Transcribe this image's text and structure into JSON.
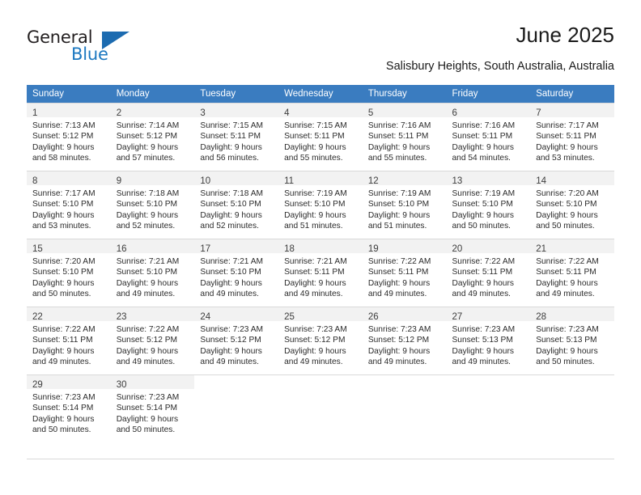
{
  "brand": {
    "name_part1": "General",
    "name_part2": "Blue",
    "accent_color": "#1c6bb0",
    "logo_icon": "triangle-flag-icon"
  },
  "header": {
    "title": "June 2025",
    "subtitle": "Salisbury Heights, South Australia, Australia"
  },
  "calendar": {
    "header_color": "#3a7cc0",
    "weekday_headers": [
      "Sunday",
      "Monday",
      "Tuesday",
      "Wednesday",
      "Thursday",
      "Friday",
      "Saturday"
    ],
    "weeks": [
      [
        {
          "day": "1",
          "sunrise": "Sunrise: 7:13 AM",
          "sunset": "Sunset: 5:12 PM",
          "daylight1": "Daylight: 9 hours",
          "daylight2": "and 58 minutes."
        },
        {
          "day": "2",
          "sunrise": "Sunrise: 7:14 AM",
          "sunset": "Sunset: 5:12 PM",
          "daylight1": "Daylight: 9 hours",
          "daylight2": "and 57 minutes."
        },
        {
          "day": "3",
          "sunrise": "Sunrise: 7:15 AM",
          "sunset": "Sunset: 5:11 PM",
          "daylight1": "Daylight: 9 hours",
          "daylight2": "and 56 minutes."
        },
        {
          "day": "4",
          "sunrise": "Sunrise: 7:15 AM",
          "sunset": "Sunset: 5:11 PM",
          "daylight1": "Daylight: 9 hours",
          "daylight2": "and 55 minutes."
        },
        {
          "day": "5",
          "sunrise": "Sunrise: 7:16 AM",
          "sunset": "Sunset: 5:11 PM",
          "daylight1": "Daylight: 9 hours",
          "daylight2": "and 55 minutes."
        },
        {
          "day": "6",
          "sunrise": "Sunrise: 7:16 AM",
          "sunset": "Sunset: 5:11 PM",
          "daylight1": "Daylight: 9 hours",
          "daylight2": "and 54 minutes."
        },
        {
          "day": "7",
          "sunrise": "Sunrise: 7:17 AM",
          "sunset": "Sunset: 5:11 PM",
          "daylight1": "Daylight: 9 hours",
          "daylight2": "and 53 minutes."
        }
      ],
      [
        {
          "day": "8",
          "sunrise": "Sunrise: 7:17 AM",
          "sunset": "Sunset: 5:10 PM",
          "daylight1": "Daylight: 9 hours",
          "daylight2": "and 53 minutes."
        },
        {
          "day": "9",
          "sunrise": "Sunrise: 7:18 AM",
          "sunset": "Sunset: 5:10 PM",
          "daylight1": "Daylight: 9 hours",
          "daylight2": "and 52 minutes."
        },
        {
          "day": "10",
          "sunrise": "Sunrise: 7:18 AM",
          "sunset": "Sunset: 5:10 PM",
          "daylight1": "Daylight: 9 hours",
          "daylight2": "and 52 minutes."
        },
        {
          "day": "11",
          "sunrise": "Sunrise: 7:19 AM",
          "sunset": "Sunset: 5:10 PM",
          "daylight1": "Daylight: 9 hours",
          "daylight2": "and 51 minutes."
        },
        {
          "day": "12",
          "sunrise": "Sunrise: 7:19 AM",
          "sunset": "Sunset: 5:10 PM",
          "daylight1": "Daylight: 9 hours",
          "daylight2": "and 51 minutes."
        },
        {
          "day": "13",
          "sunrise": "Sunrise: 7:19 AM",
          "sunset": "Sunset: 5:10 PM",
          "daylight1": "Daylight: 9 hours",
          "daylight2": "and 50 minutes."
        },
        {
          "day": "14",
          "sunrise": "Sunrise: 7:20 AM",
          "sunset": "Sunset: 5:10 PM",
          "daylight1": "Daylight: 9 hours",
          "daylight2": "and 50 minutes."
        }
      ],
      [
        {
          "day": "15",
          "sunrise": "Sunrise: 7:20 AM",
          "sunset": "Sunset: 5:10 PM",
          "daylight1": "Daylight: 9 hours",
          "daylight2": "and 50 minutes."
        },
        {
          "day": "16",
          "sunrise": "Sunrise: 7:21 AM",
          "sunset": "Sunset: 5:10 PM",
          "daylight1": "Daylight: 9 hours",
          "daylight2": "and 49 minutes."
        },
        {
          "day": "17",
          "sunrise": "Sunrise: 7:21 AM",
          "sunset": "Sunset: 5:10 PM",
          "daylight1": "Daylight: 9 hours",
          "daylight2": "and 49 minutes."
        },
        {
          "day": "18",
          "sunrise": "Sunrise: 7:21 AM",
          "sunset": "Sunset: 5:11 PM",
          "daylight1": "Daylight: 9 hours",
          "daylight2": "and 49 minutes."
        },
        {
          "day": "19",
          "sunrise": "Sunrise: 7:22 AM",
          "sunset": "Sunset: 5:11 PM",
          "daylight1": "Daylight: 9 hours",
          "daylight2": "and 49 minutes."
        },
        {
          "day": "20",
          "sunrise": "Sunrise: 7:22 AM",
          "sunset": "Sunset: 5:11 PM",
          "daylight1": "Daylight: 9 hours",
          "daylight2": "and 49 minutes."
        },
        {
          "day": "21",
          "sunrise": "Sunrise: 7:22 AM",
          "sunset": "Sunset: 5:11 PM",
          "daylight1": "Daylight: 9 hours",
          "daylight2": "and 49 minutes."
        }
      ],
      [
        {
          "day": "22",
          "sunrise": "Sunrise: 7:22 AM",
          "sunset": "Sunset: 5:11 PM",
          "daylight1": "Daylight: 9 hours",
          "daylight2": "and 49 minutes."
        },
        {
          "day": "23",
          "sunrise": "Sunrise: 7:22 AM",
          "sunset": "Sunset: 5:12 PM",
          "daylight1": "Daylight: 9 hours",
          "daylight2": "and 49 minutes."
        },
        {
          "day": "24",
          "sunrise": "Sunrise: 7:23 AM",
          "sunset": "Sunset: 5:12 PM",
          "daylight1": "Daylight: 9 hours",
          "daylight2": "and 49 minutes."
        },
        {
          "day": "25",
          "sunrise": "Sunrise: 7:23 AM",
          "sunset": "Sunset: 5:12 PM",
          "daylight1": "Daylight: 9 hours",
          "daylight2": "and 49 minutes."
        },
        {
          "day": "26",
          "sunrise": "Sunrise: 7:23 AM",
          "sunset": "Sunset: 5:12 PM",
          "daylight1": "Daylight: 9 hours",
          "daylight2": "and 49 minutes."
        },
        {
          "day": "27",
          "sunrise": "Sunrise: 7:23 AM",
          "sunset": "Sunset: 5:13 PM",
          "daylight1": "Daylight: 9 hours",
          "daylight2": "and 49 minutes."
        },
        {
          "day": "28",
          "sunrise": "Sunrise: 7:23 AM",
          "sunset": "Sunset: 5:13 PM",
          "daylight1": "Daylight: 9 hours",
          "daylight2": "and 50 minutes."
        }
      ],
      [
        {
          "day": "29",
          "sunrise": "Sunrise: 7:23 AM",
          "sunset": "Sunset: 5:14 PM",
          "daylight1": "Daylight: 9 hours",
          "daylight2": "and 50 minutes."
        },
        {
          "day": "30",
          "sunrise": "Sunrise: 7:23 AM",
          "sunset": "Sunset: 5:14 PM",
          "daylight1": "Daylight: 9 hours",
          "daylight2": "and 50 minutes."
        },
        null,
        null,
        null,
        null,
        null
      ]
    ]
  }
}
